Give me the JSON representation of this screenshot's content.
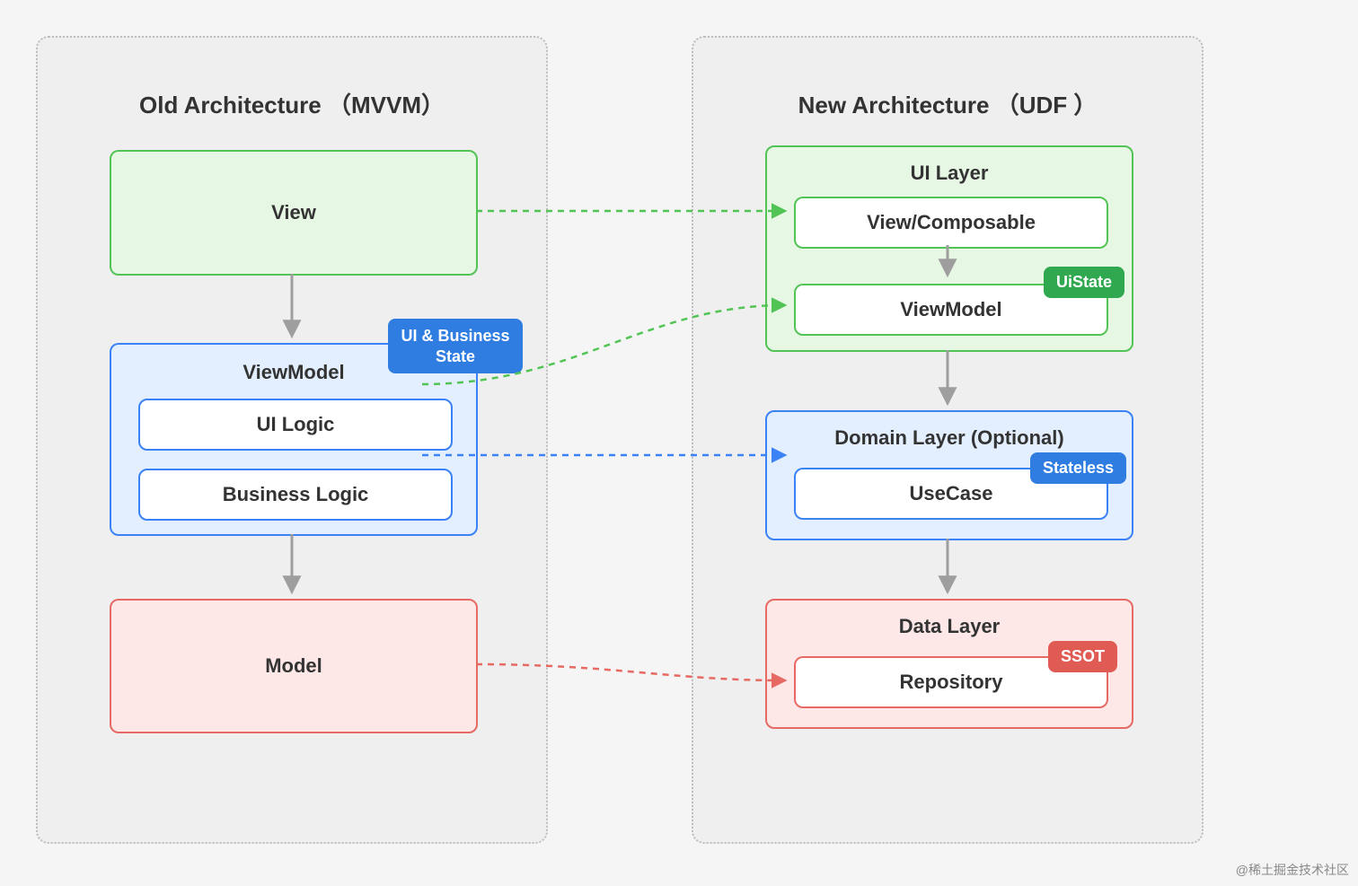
{
  "left": {
    "title": "Old Architecture  （MVVM）",
    "view": "View",
    "viewmodel": {
      "title": "ViewModel",
      "badge": "UI & Business\nState",
      "ui_logic": "UI Logic",
      "business_logic": "Business Logic"
    },
    "model": "Model"
  },
  "right": {
    "title": "New Architecture  （UDF ）",
    "ui_layer": {
      "title": "UI Layer",
      "view_composable": "View/Composable",
      "viewmodel": "ViewModel",
      "badge": "UiState"
    },
    "domain_layer": {
      "title": "Domain Layer (Optional)",
      "usecase": "UseCase",
      "badge": "Stateless"
    },
    "data_layer": {
      "title": "Data Layer",
      "repository": "Repository",
      "badge": "SSOT"
    }
  },
  "watermark": "@稀土掘金技术社区",
  "colors": {
    "green": "#52c455",
    "blue": "#3b82f6",
    "red": "#e66a63",
    "gray_arrow": "#9e9e9e"
  },
  "connectors": [
    {
      "from": "left.view",
      "to": "right.ui_layer.view_composable",
      "color": "green",
      "style": "dashed"
    },
    {
      "from": "left.viewmodel.ui_logic",
      "to": "right.ui_layer.viewmodel",
      "color": "green",
      "style": "dashed"
    },
    {
      "from": "left.viewmodel.business_logic",
      "to": "right.domain_layer.usecase",
      "color": "blue",
      "style": "dashed"
    },
    {
      "from": "left.model",
      "to": "right.data_layer.repository",
      "color": "red",
      "style": "dashed"
    },
    {
      "from": "left.view",
      "to": "left.viewmodel",
      "color": "gray",
      "style": "solid"
    },
    {
      "from": "left.viewmodel",
      "to": "left.model",
      "color": "gray",
      "style": "solid"
    },
    {
      "from": "right.ui_layer.view_composable",
      "to": "right.ui_layer.viewmodel",
      "color": "gray",
      "style": "solid"
    },
    {
      "from": "right.ui_layer",
      "to": "right.domain_layer",
      "color": "gray",
      "style": "solid"
    },
    {
      "from": "right.domain_layer",
      "to": "right.data_layer",
      "color": "gray",
      "style": "solid"
    }
  ]
}
